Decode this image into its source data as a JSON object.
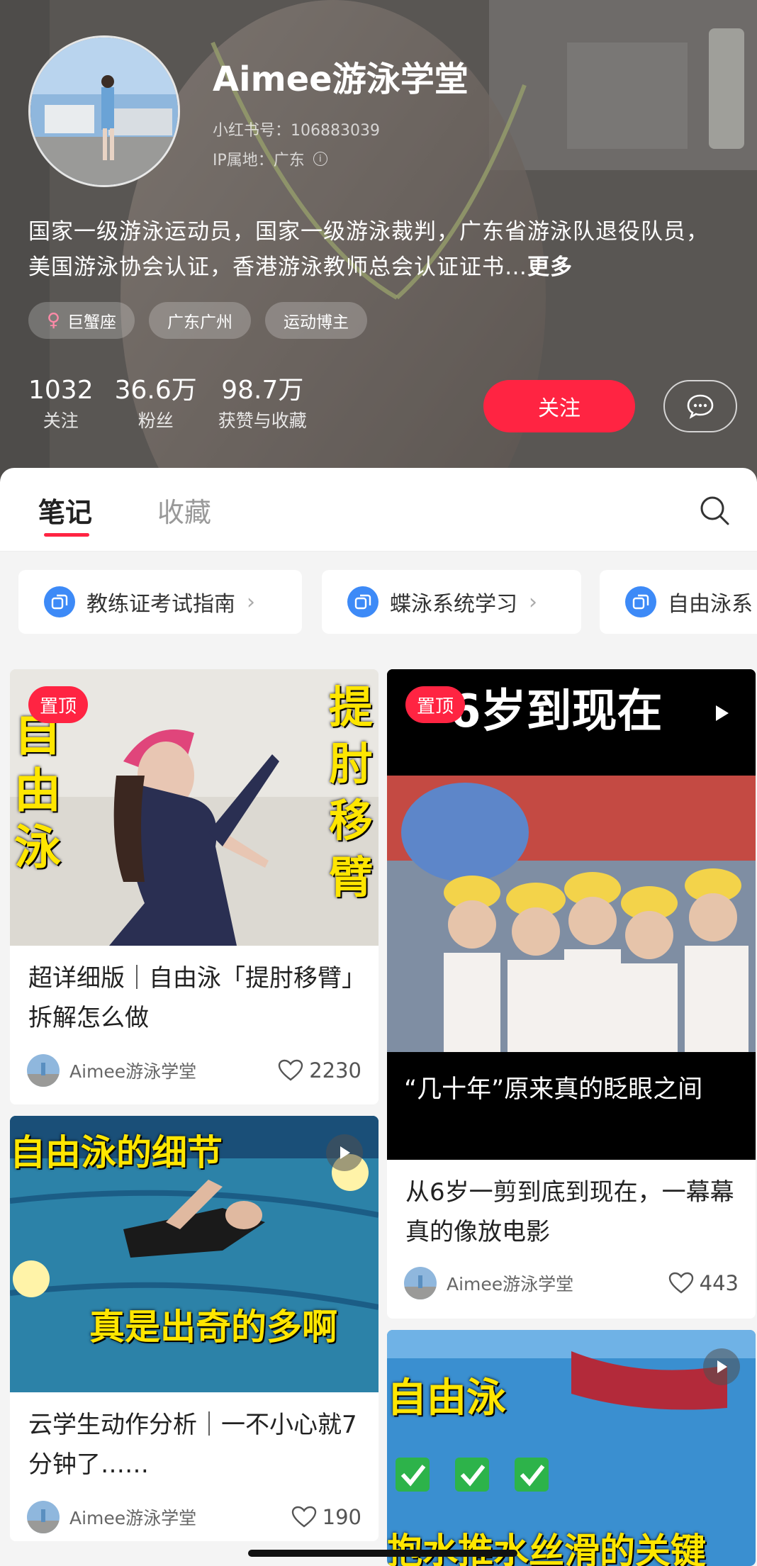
{
  "profile": {
    "nickname": "Aimee游泳学堂",
    "red_id": "小红书号：106883039",
    "ip_location": "IP属地：广东",
    "bio": "国家一级游泳运动员，国家一级游泳裁判，广东省游泳队退役队员，美国游泳协会认证，香港游泳教师总会认证证书…",
    "bio_more": "更多",
    "tags": [
      {
        "label": "巨蟹座",
        "icon": "female-icon"
      },
      {
        "label": "广东广州"
      },
      {
        "label": "运动博主"
      }
    ],
    "stats": [
      {
        "value": "1032",
        "label": "关注"
      },
      {
        "value": "36.6万",
        "label": "粉丝"
      },
      {
        "value": "98.7万",
        "label": "获赞与收藏"
      }
    ],
    "follow_label": "关注",
    "message_icon": "chat-bubble-icon"
  },
  "tabs": [
    {
      "label": "笔记",
      "active": true
    },
    {
      "label": "收藏",
      "active": false
    }
  ],
  "search_icon": "search-icon",
  "collections": [
    {
      "label": "教练证考试指南"
    },
    {
      "label": "蝶泳系统学习"
    },
    {
      "label": "自由泳系"
    }
  ],
  "notes": [
    {
      "pin": "置顶",
      "overlay_left": "自由泳",
      "overlay_right": "提肘移臂",
      "title": "超详细版｜自由泳「提肘移臂」拆解怎么做",
      "author": "Aimee游泳学堂",
      "likes": "2230"
    },
    {
      "pin": "置顶",
      "overlay_top": "6岁到现在",
      "overlay_bottom": "“几十年”原来真的眨眼之间",
      "title": "从6岁一剪到底到现在，一幕幕真的像放电影",
      "author": "Aimee游泳学堂",
      "likes": "443"
    },
    {
      "overlay_top": "自由泳的细节",
      "overlay_bottom": "真是出奇的多啊",
      "title": "云学生动作分析｜一不小心就7分钟了……",
      "author": "Aimee游泳学堂",
      "likes": "190"
    },
    {
      "overlay_top": "自由泳",
      "overlay_bottom": "抱水推水丝滑的关键"
    }
  ]
}
